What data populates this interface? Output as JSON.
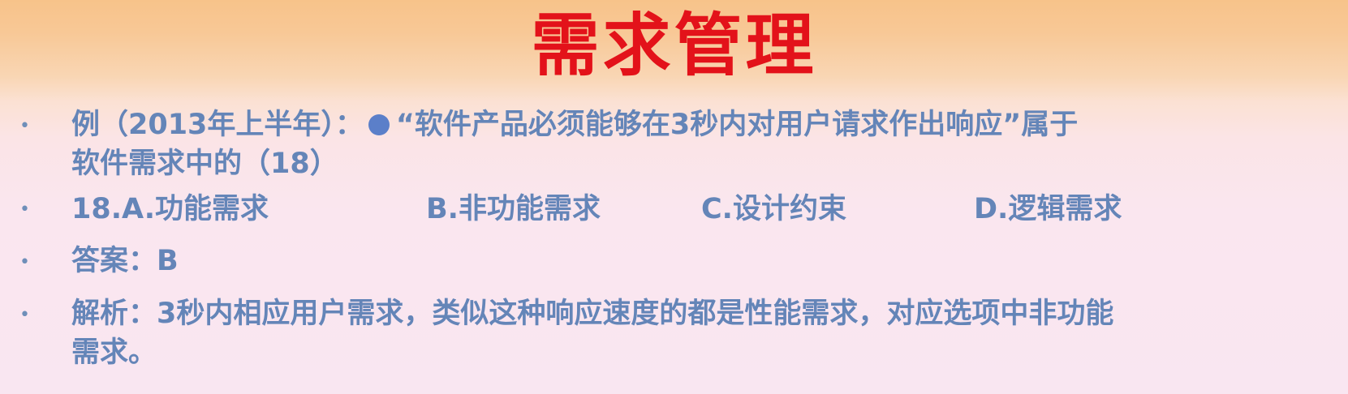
{
  "slide": {
    "title": "需求管理",
    "question": {
      "prefix": "例（2013年上半年）：",
      "bullet_icon": "filled-circle",
      "line1_text": "“软件产品必须能够在3秒内对用户请求作出响应”属于",
      "line2_text": "软件需求中的（18）"
    },
    "options": {
      "a": "18.A.功能需求",
      "b": "B.非功能需求",
      "c": "C.设计约束",
      "d": "D.逻辑需求"
    },
    "answer": "答案：B",
    "analysis": {
      "line1": "解析：3秒内相应用户需求，类似这种响应速度的都是性能需求，对应选项中非功能",
      "line2": "需求。"
    },
    "colors": {
      "title": "#e3121a",
      "body_text": "#6485b8",
      "bullet_dot": "#5b7fc9",
      "header_bg": "#f7c38a",
      "body_bg": "#f9e6f1"
    }
  }
}
